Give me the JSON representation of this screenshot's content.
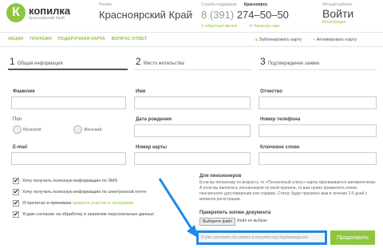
{
  "header": {
    "logo_letter": "К",
    "logo_text": "копилка",
    "logo_sub": "Красноярский Край",
    "region_label": "Регион",
    "region_value": "Красноярский Край",
    "support_label": "Служба поддержки",
    "support_city": "Красноярск",
    "phone_prefix": "8 (391)",
    "phone_number": "274–50–50",
    "feedback_link": "обратный звонок",
    "write_link": "Написать нам",
    "office_label": "Личный кабинет",
    "login_label": "Войти",
    "register_link": "Регистрация"
  },
  "nav": {
    "items": [
      "АКЦИИ",
      "ПЛАТЕЖИ",
      "ПОДАРОЧНАЯ КАРТА",
      "ВОПРОС-ОТВЕТ"
    ],
    "block_card": "Заблокировать карту",
    "activate_card": "Активировать карту"
  },
  "steps": [
    {
      "num": "1",
      "label": "Общая информация"
    },
    {
      "num": "2",
      "label": "Место жительства"
    },
    {
      "num": "3",
      "label": "Подтверждение заявки"
    }
  ],
  "form": {
    "surname_label": "Фамилия",
    "name_label": "Имя",
    "patronymic_label": "Отчество",
    "gender_label": "Пол",
    "male_label": "Мужской",
    "female_label": "Женский",
    "birthdate_label": "Дата рождения",
    "phone_label": "Номер телефона",
    "email_label": "E-mail",
    "card_label": "Номер карты",
    "keyword_label": "Ключевое слово"
  },
  "checks": [
    {
      "text": "Хочу получать полезную информацию по SMS",
      "link": ""
    },
    {
      "text": "Хочу получать полезную информацию по электронной почте",
      "link": ""
    },
    {
      "text": "Я прочитал и принимаю ",
      "link": "правила участия в программе"
    },
    {
      "text": "Я даю согласие на обработку и хранение персональных данных",
      "link": ""
    }
  ],
  "pensioners": {
    "title": "Для пенсионеров",
    "text": "Если вы пенсионер по возрасту, то «Пенсионный статус» карты присваивается автоматически. А если вы являетесь пенсионером по иной причине, то вам нужно прикрепить копию пенсионного удостоверения или справки. Статус будет присвоен вам в течение 3-5 дней с момента регистрации.",
    "attach_title": "Прикрепить копию документа",
    "file_button": "Выберите файл",
    "file_none": "Файл не выбран"
  },
  "confirm_text": "Я уже заполнил эту анкету и получил код подтверждения",
  "submit_label": "Продолжить",
  "colors": {
    "accent": "#8dc63f",
    "highlight": "#1e88e5"
  }
}
